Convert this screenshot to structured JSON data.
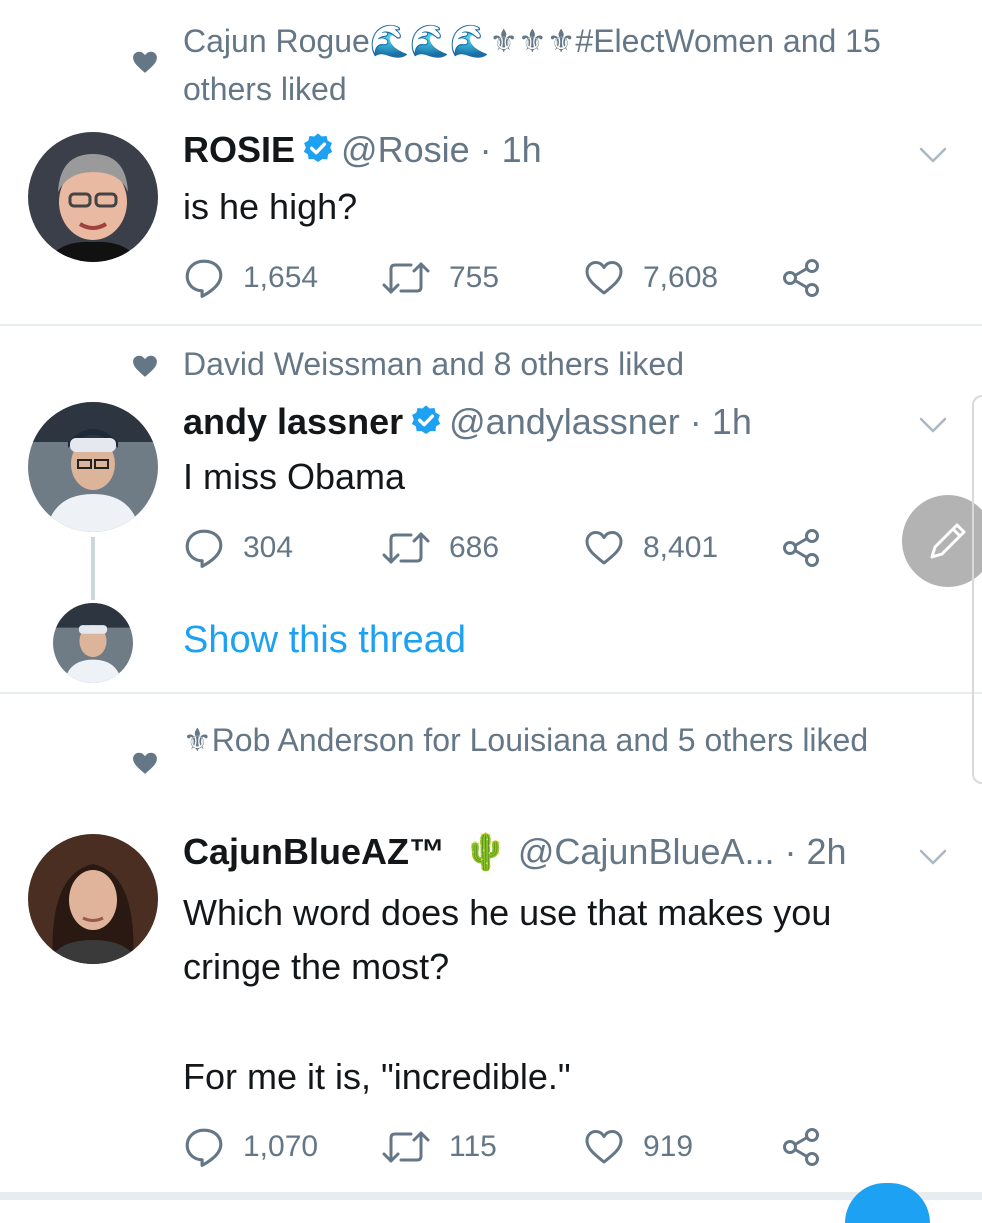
{
  "tweets": [
    {
      "social_context": "Cajun Rogue🌊🌊🌊⚜⚜⚜#ElectWomen and 15 others liked",
      "name": "ROSIE",
      "verified": true,
      "handle": "@Rosie",
      "time": "1h",
      "text": "is he high?",
      "replies": "1,654",
      "retweets": "755",
      "likes": "7,608"
    },
    {
      "social_context": "David Weissman and 8 others liked",
      "name": "andy lassner",
      "verified": true,
      "handle": "@andylassner",
      "time": "1h",
      "text": "I miss Obama",
      "replies": "304",
      "retweets": "686",
      "likes": "8,401",
      "show_thread": "Show this thread"
    },
    {
      "social_context": "⚜Rob Anderson for Louisiana and 5 others liked",
      "name": "CajunBlueAZ™",
      "name_emoji": "🌵",
      "verified": false,
      "handle": "@CajunBlueA...",
      "time": "2h",
      "text_line1": "Which word does he use that makes you",
      "text_line2": "cringe the most?",
      "text_line3": "For me it is, \"incredible.\"",
      "replies": "1,070",
      "retweets": "115",
      "likes": "919"
    }
  ],
  "colors": {
    "accent": "#1da1f2",
    "secondary_text": "#657786",
    "primary_text": "#14171a",
    "divider": "#e6ecf0"
  },
  "icons": [
    "heart-icon",
    "verified-icon",
    "chevron-down-icon",
    "reply-icon",
    "retweet-icon",
    "like-icon",
    "share-icon",
    "compose-icon"
  ]
}
